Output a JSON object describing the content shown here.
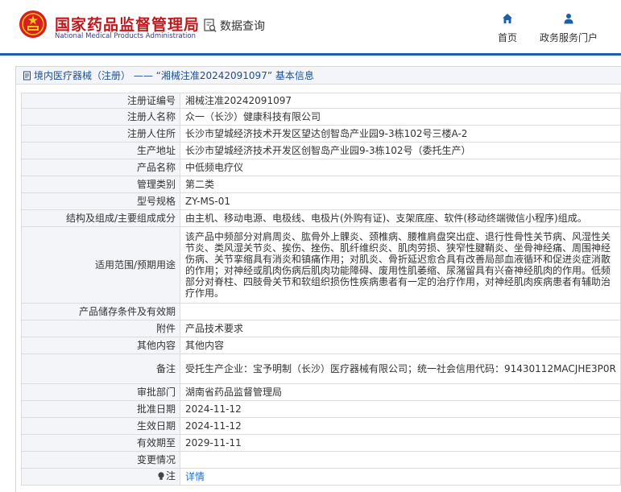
{
  "header": {
    "brand_cn": "国家药品监督管理局",
    "brand_en": "National Medical Products Administration",
    "data_query": "数据查询",
    "nav_home": "首页",
    "nav_service": "政务服务门户"
  },
  "title_bar": {
    "text": "境内医疗器械（注册） —— “湘械注准20242091097” 基本信息"
  },
  "rows": [
    {
      "key": "注册证编号",
      "value": "湘械注准20242091097"
    },
    {
      "key": "注册人名称",
      "value": "众一（长沙）健康科技有限公司"
    },
    {
      "key": "注册人住所",
      "value": "长沙市望城经济技术开发区望达创智岛产业园9-3栋102号三楼A-2"
    },
    {
      "key": "生产地址",
      "value": "长沙市望城经济技术开发区创智岛产业园9-3栋102号（委托生产）"
    },
    {
      "key": "产品名称",
      "value": "中低频电疗仪"
    },
    {
      "key": "管理类别",
      "value": "第二类"
    },
    {
      "key": "型号规格",
      "value": "ZY-MS-01"
    },
    {
      "key": "结构及组成/主要组成成分",
      "value": "由主机、移动电源、电极线、电极片(外购有证)、支架底座、软件(移动终端微信小程序)组成。"
    },
    {
      "key": "适用范围/预期用途",
      "value": "该产品中频部分对肩周炎、肱骨外上髁炎、颈椎病、腰椎肩盘突出症、退行性骨性关节病、风湿性关节炎、类风湿关节炎、挨伤、挫伤、肌纤维织炎、肌肉劳损、狭窄性腱鞘炎、坐骨神经痛、周围神经伤病、关节挛缩具有消炎和镇痛作用；对肌炎、骨折延迟愈合具有改善局部血液循环和促进炎症消散的作用；对神经或肌肉伤病后肌肉功能障碍、废用性肌萎缩、尿潴留具有兴奋神经肌肉的作用。低频部分对脊柱、四肢骨关节和软组织损伤性疾病患者有一定的治疗作用，对神经肌肉疾病患者有辅助治疗作用。"
    },
    {
      "key": "产品储存条件及有效期",
      "value": ""
    },
    {
      "key": "附件",
      "value": "产品技术要求"
    },
    {
      "key": "其他内容",
      "value": "其他内容"
    },
    {
      "key": "备注",
      "value": "受托生产企业：宝予明制（长沙）医疗器械有限公司；统一社会信用代码：91430112MACJHE3P0R"
    },
    {
      "key": "审批部门",
      "value": "湖南省药品监督管理局"
    },
    {
      "key": "批准日期",
      "value": "2024-11-12"
    },
    {
      "key": "生效日期",
      "value": "2024-11-12"
    },
    {
      "key": "有效期至",
      "value": "2029-11-11"
    },
    {
      "key": "变更情况",
      "value": ""
    },
    {
      "key": "注",
      "value": "详情"
    }
  ]
}
